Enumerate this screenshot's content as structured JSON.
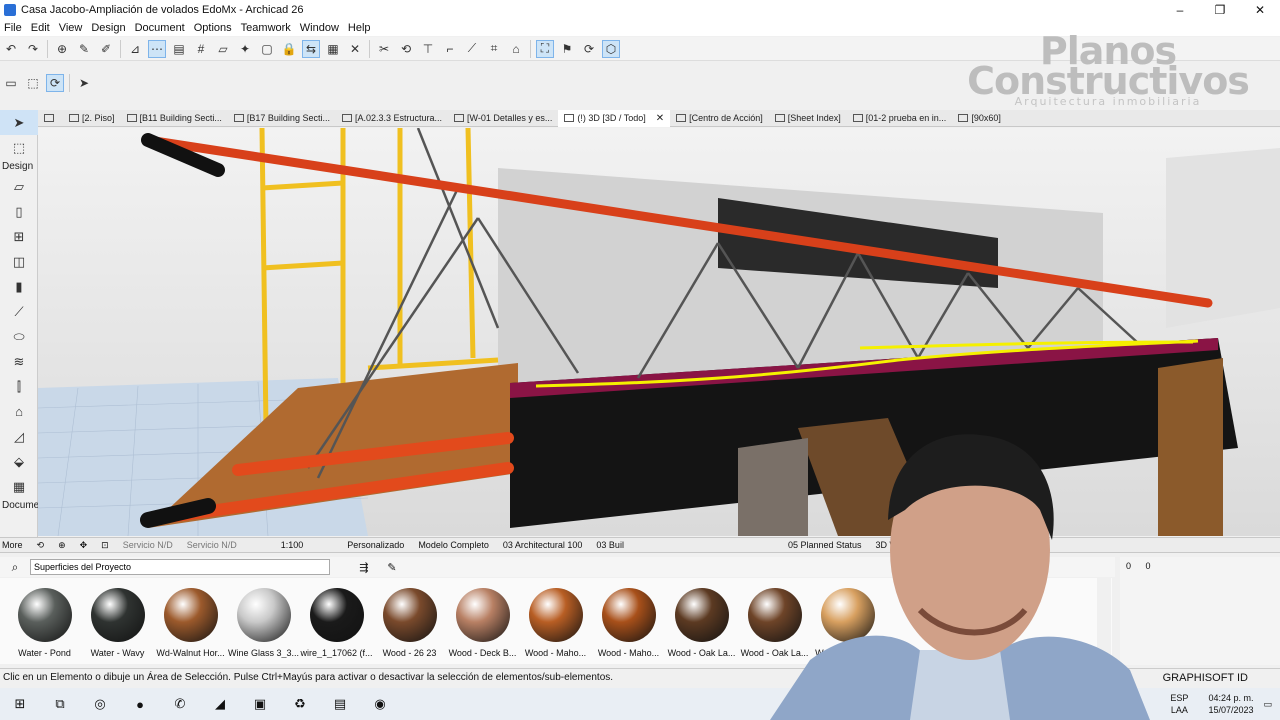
{
  "window": {
    "title": "Casa Jacobo-Ampliación de volados EdoMx - Archicad 26",
    "controls": [
      "–",
      "❐",
      "✕"
    ]
  },
  "menu": [
    "File",
    "Edit",
    "View",
    "Design",
    "Document",
    "Options",
    "Teamwork",
    "Window",
    "Help"
  ],
  "watermark": {
    "line1": "Planos",
    "line2": "Constructivos",
    "line3": "Arquitectura inmobiliaria"
  },
  "toolbox": {
    "design_label": "Design",
    "document_label": "Documer",
    "more_label": "More"
  },
  "tabs": [
    {
      "label": "[2. Piso]",
      "active": false
    },
    {
      "label": "[B11 Building Secti...",
      "active": false
    },
    {
      "label": "[B17 Building Secti...",
      "active": false
    },
    {
      "label": "[A.02.3.3 Estructura...",
      "active": false
    },
    {
      "label": "[W-01 Detalles y es...",
      "active": false
    },
    {
      "label": "(!) 3D [3D / Todo]",
      "active": true
    },
    {
      "label": "[Centro de Acción]",
      "active": false
    },
    {
      "label": "[Sheet Index]",
      "active": false
    },
    {
      "label": "[01-2 prueba en in...",
      "active": false
    },
    {
      "label": "[90x60]",
      "active": false
    }
  ],
  "view_status": {
    "servicio1": "Servicio N/D",
    "servicio2": "Servicio N/D",
    "scale": "1:100",
    "override": "Personalizado",
    "model": "Modelo Completo",
    "pen": "03 Architectural 100",
    "dim": "03 Buil",
    "renovation": "05 Planned Status",
    "window_style": "3D Window Style"
  },
  "materials": {
    "search_value": "Superficies del Proyecto",
    "right_a": "0",
    "right_b": "0",
    "items": [
      {
        "name": "Water - Pond",
        "color": "#5a5f5c"
      },
      {
        "name": "Water - Wavy",
        "color": "#2f3331"
      },
      {
        "name": "Wd-Walnut Hor...",
        "color": "#9c5a2c"
      },
      {
        "name": "Wine Glass 3_3...",
        "color": "#c9c9c9"
      },
      {
        "name": "wire_1_17062 (f...",
        "color": "#1a1a1a"
      },
      {
        "name": "Wood - 26 23",
        "color": "#7a4a2c"
      },
      {
        "name": "Wood - Deck B...",
        "color": "#b88064"
      },
      {
        "name": "Wood - Maho...",
        "color": "#b85e24"
      },
      {
        "name": "Wood - Maho...",
        "color": "#a8501a"
      },
      {
        "name": "Wood - Oak La...",
        "color": "#5c3a22"
      },
      {
        "name": "Wood - Oak La...",
        "color": "#6e4428"
      },
      {
        "name": "Wood - Oak Li...",
        "color": "#d8a060"
      }
    ]
  },
  "status_message": "Clic en un Elemento o dibuje un Área de Selección. Pulse Ctrl+Mayús para activar o desactivar la selección de elementos/sub-elementos.",
  "graphisoft": "GRAPHISOFT ID",
  "tray": {
    "lang1": "ESP",
    "lang2": "LAA",
    "time": "04:24 p. m.",
    "date": "15/07/2023"
  }
}
